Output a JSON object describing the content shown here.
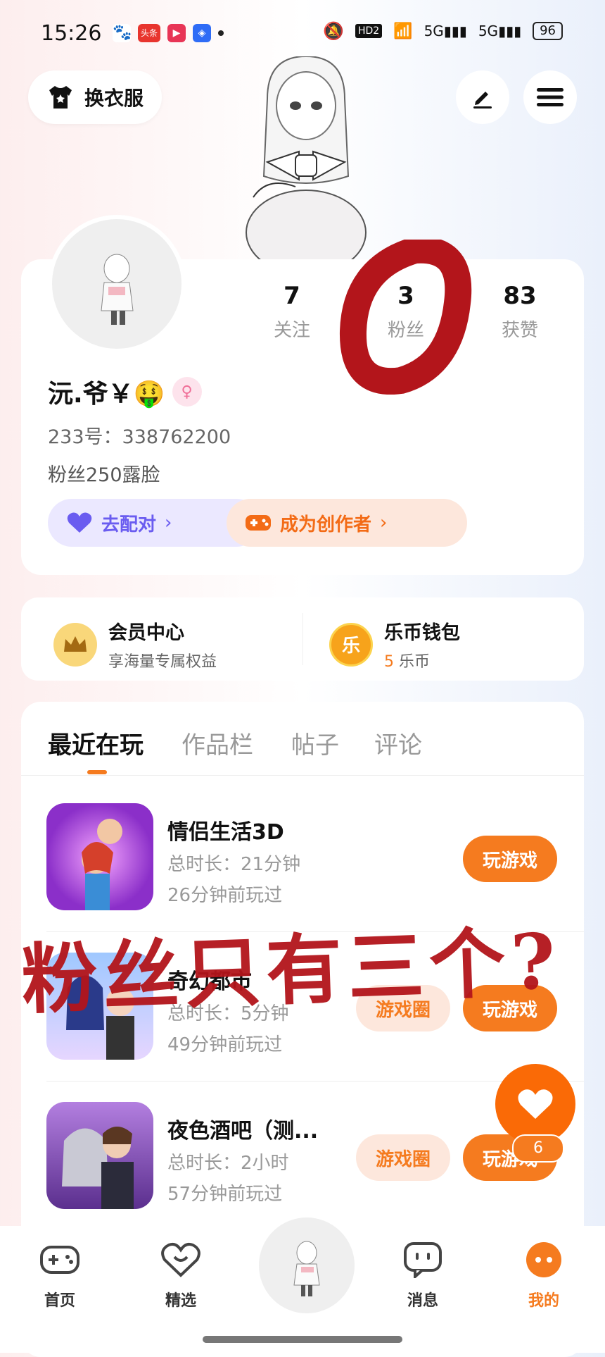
{
  "status_bar": {
    "time": "15:26",
    "app_badge": "头条",
    "net1": "5G",
    "net2": "5G",
    "battery": "96",
    "hd": "HD2"
  },
  "header": {
    "wardrobe_label": "换衣服"
  },
  "profile": {
    "stats": [
      {
        "value": "7",
        "label": "关注"
      },
      {
        "value": "3",
        "label": "粉丝"
      },
      {
        "value": "83",
        "label": "获赞"
      }
    ],
    "nickname": "沅.爷￥🤑",
    "uid": "233号：338762200",
    "bio": "粉丝250露脸",
    "pair_label": "去配对",
    "creator_label": "成为创作者"
  },
  "member": {
    "vip_title": "会员中心",
    "vip_sub": "享海量专属权益",
    "coin_title": "乐币钱包",
    "coin_count": "5",
    "coin_unit": "乐币",
    "coin_icon_char": "乐"
  },
  "tabs": [
    "最近在玩",
    "作品栏",
    "帖子",
    "评论"
  ],
  "games": [
    {
      "name": "情侣生活3D",
      "duration": "总时长：21分钟",
      "last": "26分钟前玩过",
      "play": "玩游戏",
      "circle": ""
    },
    {
      "name": "奇幻都市",
      "duration": "总时长：5分钟",
      "last": "49分钟前玩过",
      "play": "玩游戏",
      "circle": "游戏圈"
    },
    {
      "name": "夜色酒吧（测...",
      "duration": "总时长：2小时",
      "last": "57分钟前玩过",
      "play": "玩游戏",
      "circle": "游戏圈"
    }
  ],
  "fab": {
    "count": "6"
  },
  "overlay": {
    "text": "粉丝只有三个?"
  },
  "nav": [
    {
      "label": "首页"
    },
    {
      "label": "精选"
    },
    {
      "label": "消息"
    },
    {
      "label": "我的"
    }
  ],
  "colors": {
    "accent": "#f57b1f",
    "pair": "#6a5cf0",
    "annotation": "#b3151b"
  }
}
